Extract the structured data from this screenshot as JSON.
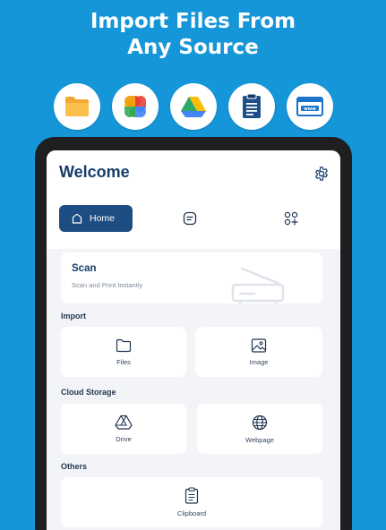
{
  "promo": {
    "headline_line1": "Import Files From",
    "headline_line2": "Any Source"
  },
  "sources": [
    {
      "icon": "folder-icon"
    },
    {
      "icon": "photos-pinwheel-icon"
    },
    {
      "icon": "drive-icon"
    },
    {
      "icon": "document-clipboard-icon"
    },
    {
      "icon": "web-www-icon"
    }
  ],
  "app": {
    "title": "Welcome",
    "nav": {
      "home_label": "Home"
    },
    "scan": {
      "title": "Scan",
      "subtitle": "Scan and Print Instantly"
    },
    "sections": {
      "import": "Import",
      "cloud": "Cloud Storage",
      "others": "Others"
    },
    "tiles": {
      "files": "Files",
      "image": "Image",
      "drive": "Drive",
      "webpage": "Webpage",
      "clipboard": "Clipboard"
    }
  },
  "colors": {
    "background": "#1596d8",
    "accent": "#1d4d82",
    "title": "#163d6b"
  }
}
